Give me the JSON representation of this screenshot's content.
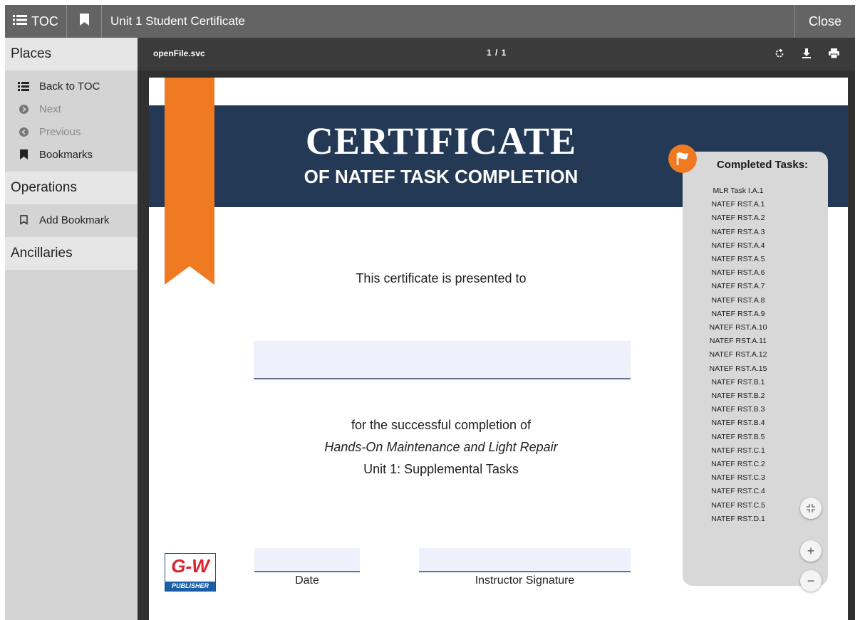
{
  "topbar": {
    "toc_label": "TOC",
    "title": "Unit 1 Student Certificate",
    "close_label": "Close"
  },
  "sidebar": {
    "places": {
      "heading": "Places",
      "items": [
        {
          "label": "Back to TOC",
          "icon": "list-icon",
          "enabled": true
        },
        {
          "label": "Next",
          "icon": "next-circle-icon",
          "enabled": false
        },
        {
          "label": "Previous",
          "icon": "previous-circle-icon",
          "enabled": false
        },
        {
          "label": "Bookmarks",
          "icon": "bookmark-icon",
          "enabled": true
        }
      ]
    },
    "operations": {
      "heading": "Operations",
      "items": [
        {
          "label": "Add Bookmark",
          "icon": "bookmark-outline-icon",
          "enabled": true
        }
      ]
    },
    "ancillaries": {
      "heading": "Ancillaries"
    }
  },
  "viewer": {
    "filename": "openFile.svc",
    "page_indicator": "1 / 1",
    "icons": [
      "rotate-icon",
      "download-icon",
      "print-icon"
    ]
  },
  "certificate": {
    "title": "CERTIFICATE",
    "subtitle": "OF NATEF TASK COMPLETION",
    "presented_to": "This certificate is presented to",
    "completion_text": "for the successful completion of",
    "course": "Hands-On Maintenance and Light Repair",
    "unit": "Unit 1: Supplemental Tasks",
    "date_label": "Date",
    "signature_label": "Instructor Signature",
    "logo_text": "G-W",
    "logo_subtext": "PUBLISHER"
  },
  "tasks_panel": {
    "heading": "Completed Tasks:",
    "items": [
      "MLR Task I.A.1",
      "NATEF RST.A.1",
      "NATEF RST.A.2",
      "NATEF RST.A.3",
      "NATEF RST.A.4",
      "NATEF RST.A.5",
      "NATEF RST.A.6",
      "NATEF RST.A.7",
      "NATEF RST.A.8",
      "NATEF RST.A.9",
      "NATEF RST.A.10",
      "NATEF RST.A.11",
      "NATEF RST.A.12",
      "NATEF RST.A.15",
      "NATEF RST.B.1",
      "NATEF RST.B.2",
      "NATEF RST.B.3",
      "NATEF RST.B.4",
      "NATEF RST.B.5",
      "NATEF RST.C.1",
      "NATEF RST.C.2",
      "NATEF RST.C.3",
      "NATEF RST.C.4",
      "NATEF RST.C.5",
      "NATEF RST.D.1"
    ]
  },
  "zoom_controls": {
    "fit_icon": "collapse-icon",
    "zoom_in_label": "+",
    "zoom_out_label": "−"
  },
  "colors": {
    "banner": "#233955",
    "ribbon": "#f07a22",
    "topbar": "#646464",
    "viewer_bar": "#3b3b3b"
  }
}
